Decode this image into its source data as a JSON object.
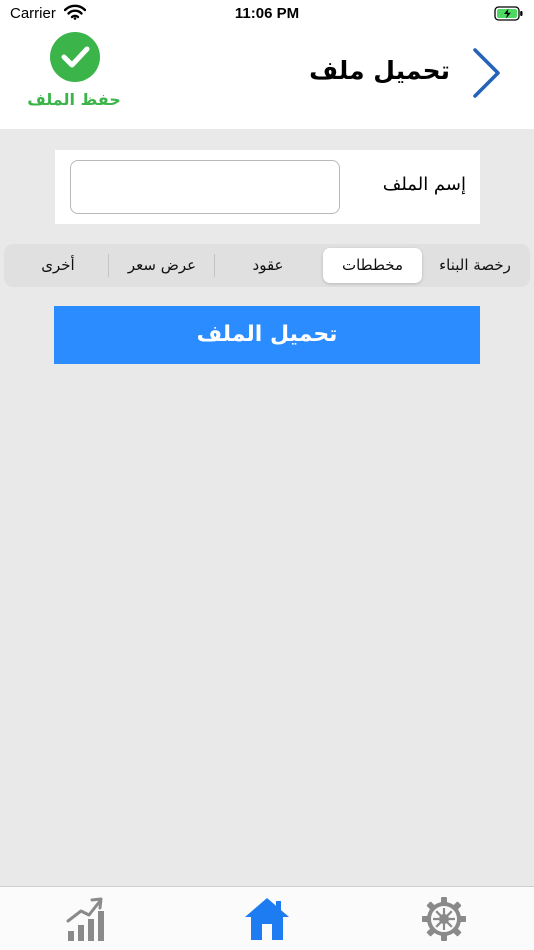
{
  "status_bar": {
    "carrier": "Carrier",
    "time": "11:06 PM",
    "wifi_icon": "wifi-icon",
    "battery_icon": "battery-charging-icon"
  },
  "header": {
    "title": "تحميل ملف",
    "save_label": "حفظ الملف",
    "save_icon": "checkmark-circle-icon",
    "back_icon": "chevron-right-icon",
    "save_color": "#3bb44a",
    "back_color": "#2563b8"
  },
  "file_name": {
    "label": "إسم الملف",
    "value": "",
    "placeholder": ""
  },
  "categories": {
    "selected": "مخططات",
    "items": [
      "رخصة البناء",
      "مخططات",
      "عقود",
      "عرض سعر",
      "أخرى"
    ]
  },
  "upload_button": {
    "label": "تحميل الملف",
    "color": "#2a8cff"
  },
  "tab_bar": {
    "active": "home",
    "accent_color": "#1d7cf2",
    "items": [
      {
        "id": "stats",
        "icon": "growth-chart-icon"
      },
      {
        "id": "home",
        "icon": "home-icon"
      },
      {
        "id": "settings",
        "icon": "gear-icon"
      }
    ]
  }
}
